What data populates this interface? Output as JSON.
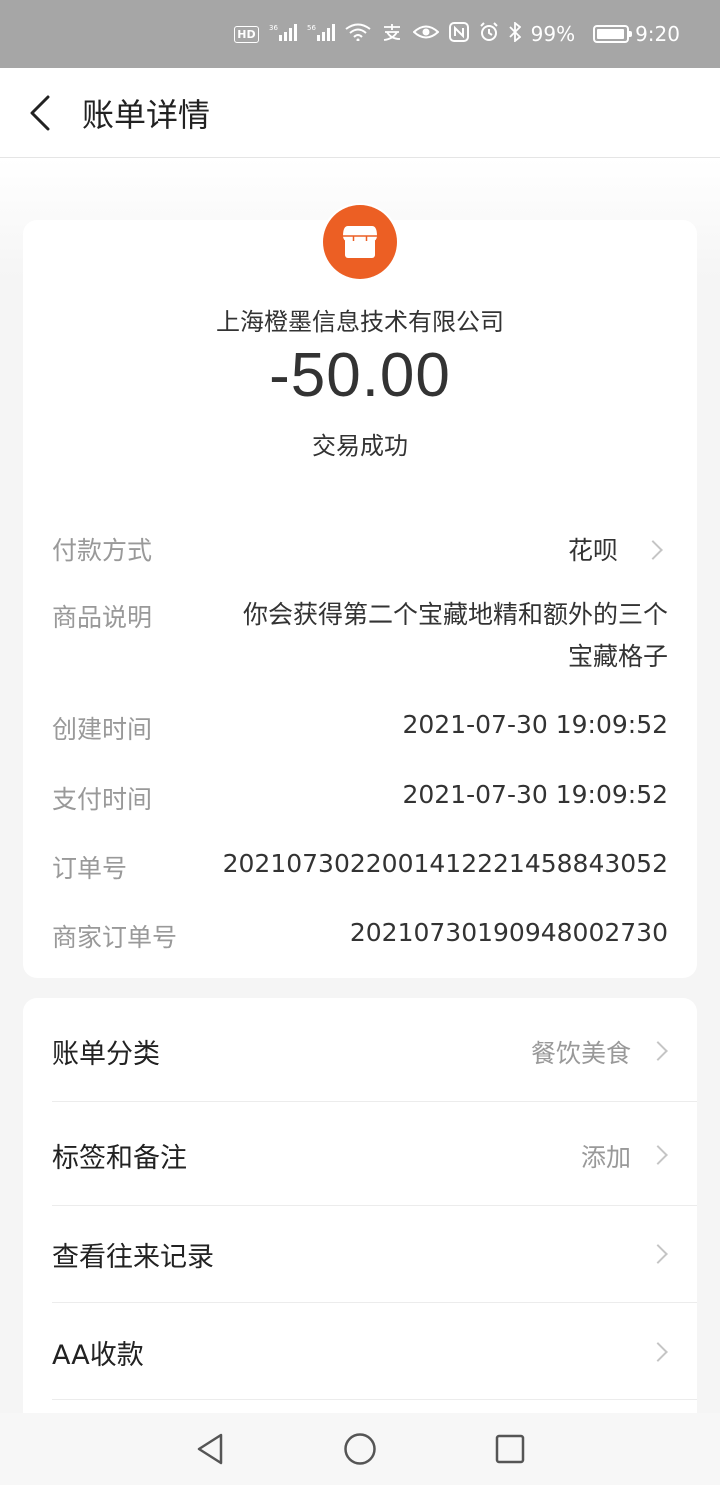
{
  "status_bar": {
    "battery": "99%",
    "time": "9:20",
    "hd_label": "HD",
    "signal1": "36",
    "signal2": "56"
  },
  "nav": {
    "title": "账单详情"
  },
  "transaction": {
    "merchant": "上海橙墨信息技术有限公司",
    "amount": "-50.00",
    "status": "交易成功"
  },
  "details": [
    {
      "label": "付款方式",
      "value": "花呗"
    },
    {
      "label": "商品说明",
      "value": "你会获得第二个宝藏地精和额外的三个宝藏格子"
    },
    {
      "label": "创建时间",
      "value": "2021-07-30 19:09:52"
    },
    {
      "label": "支付时间",
      "value": "2021-07-30 19:09:52"
    },
    {
      "label": "订单号",
      "value": "2021073022001412221458843052"
    },
    {
      "label": "商家订单号",
      "value": "20210730190948002730"
    }
  ],
  "menu": [
    {
      "label": "账单分类",
      "value": "餐饮美食"
    },
    {
      "label": "标签和备注",
      "value": "添加"
    },
    {
      "label": "查看往来记录",
      "value": ""
    },
    {
      "label": "AA收款",
      "value": ""
    }
  ],
  "colors": {
    "accent": "#ec5f24",
    "status_bar": "#a6a6a6"
  }
}
